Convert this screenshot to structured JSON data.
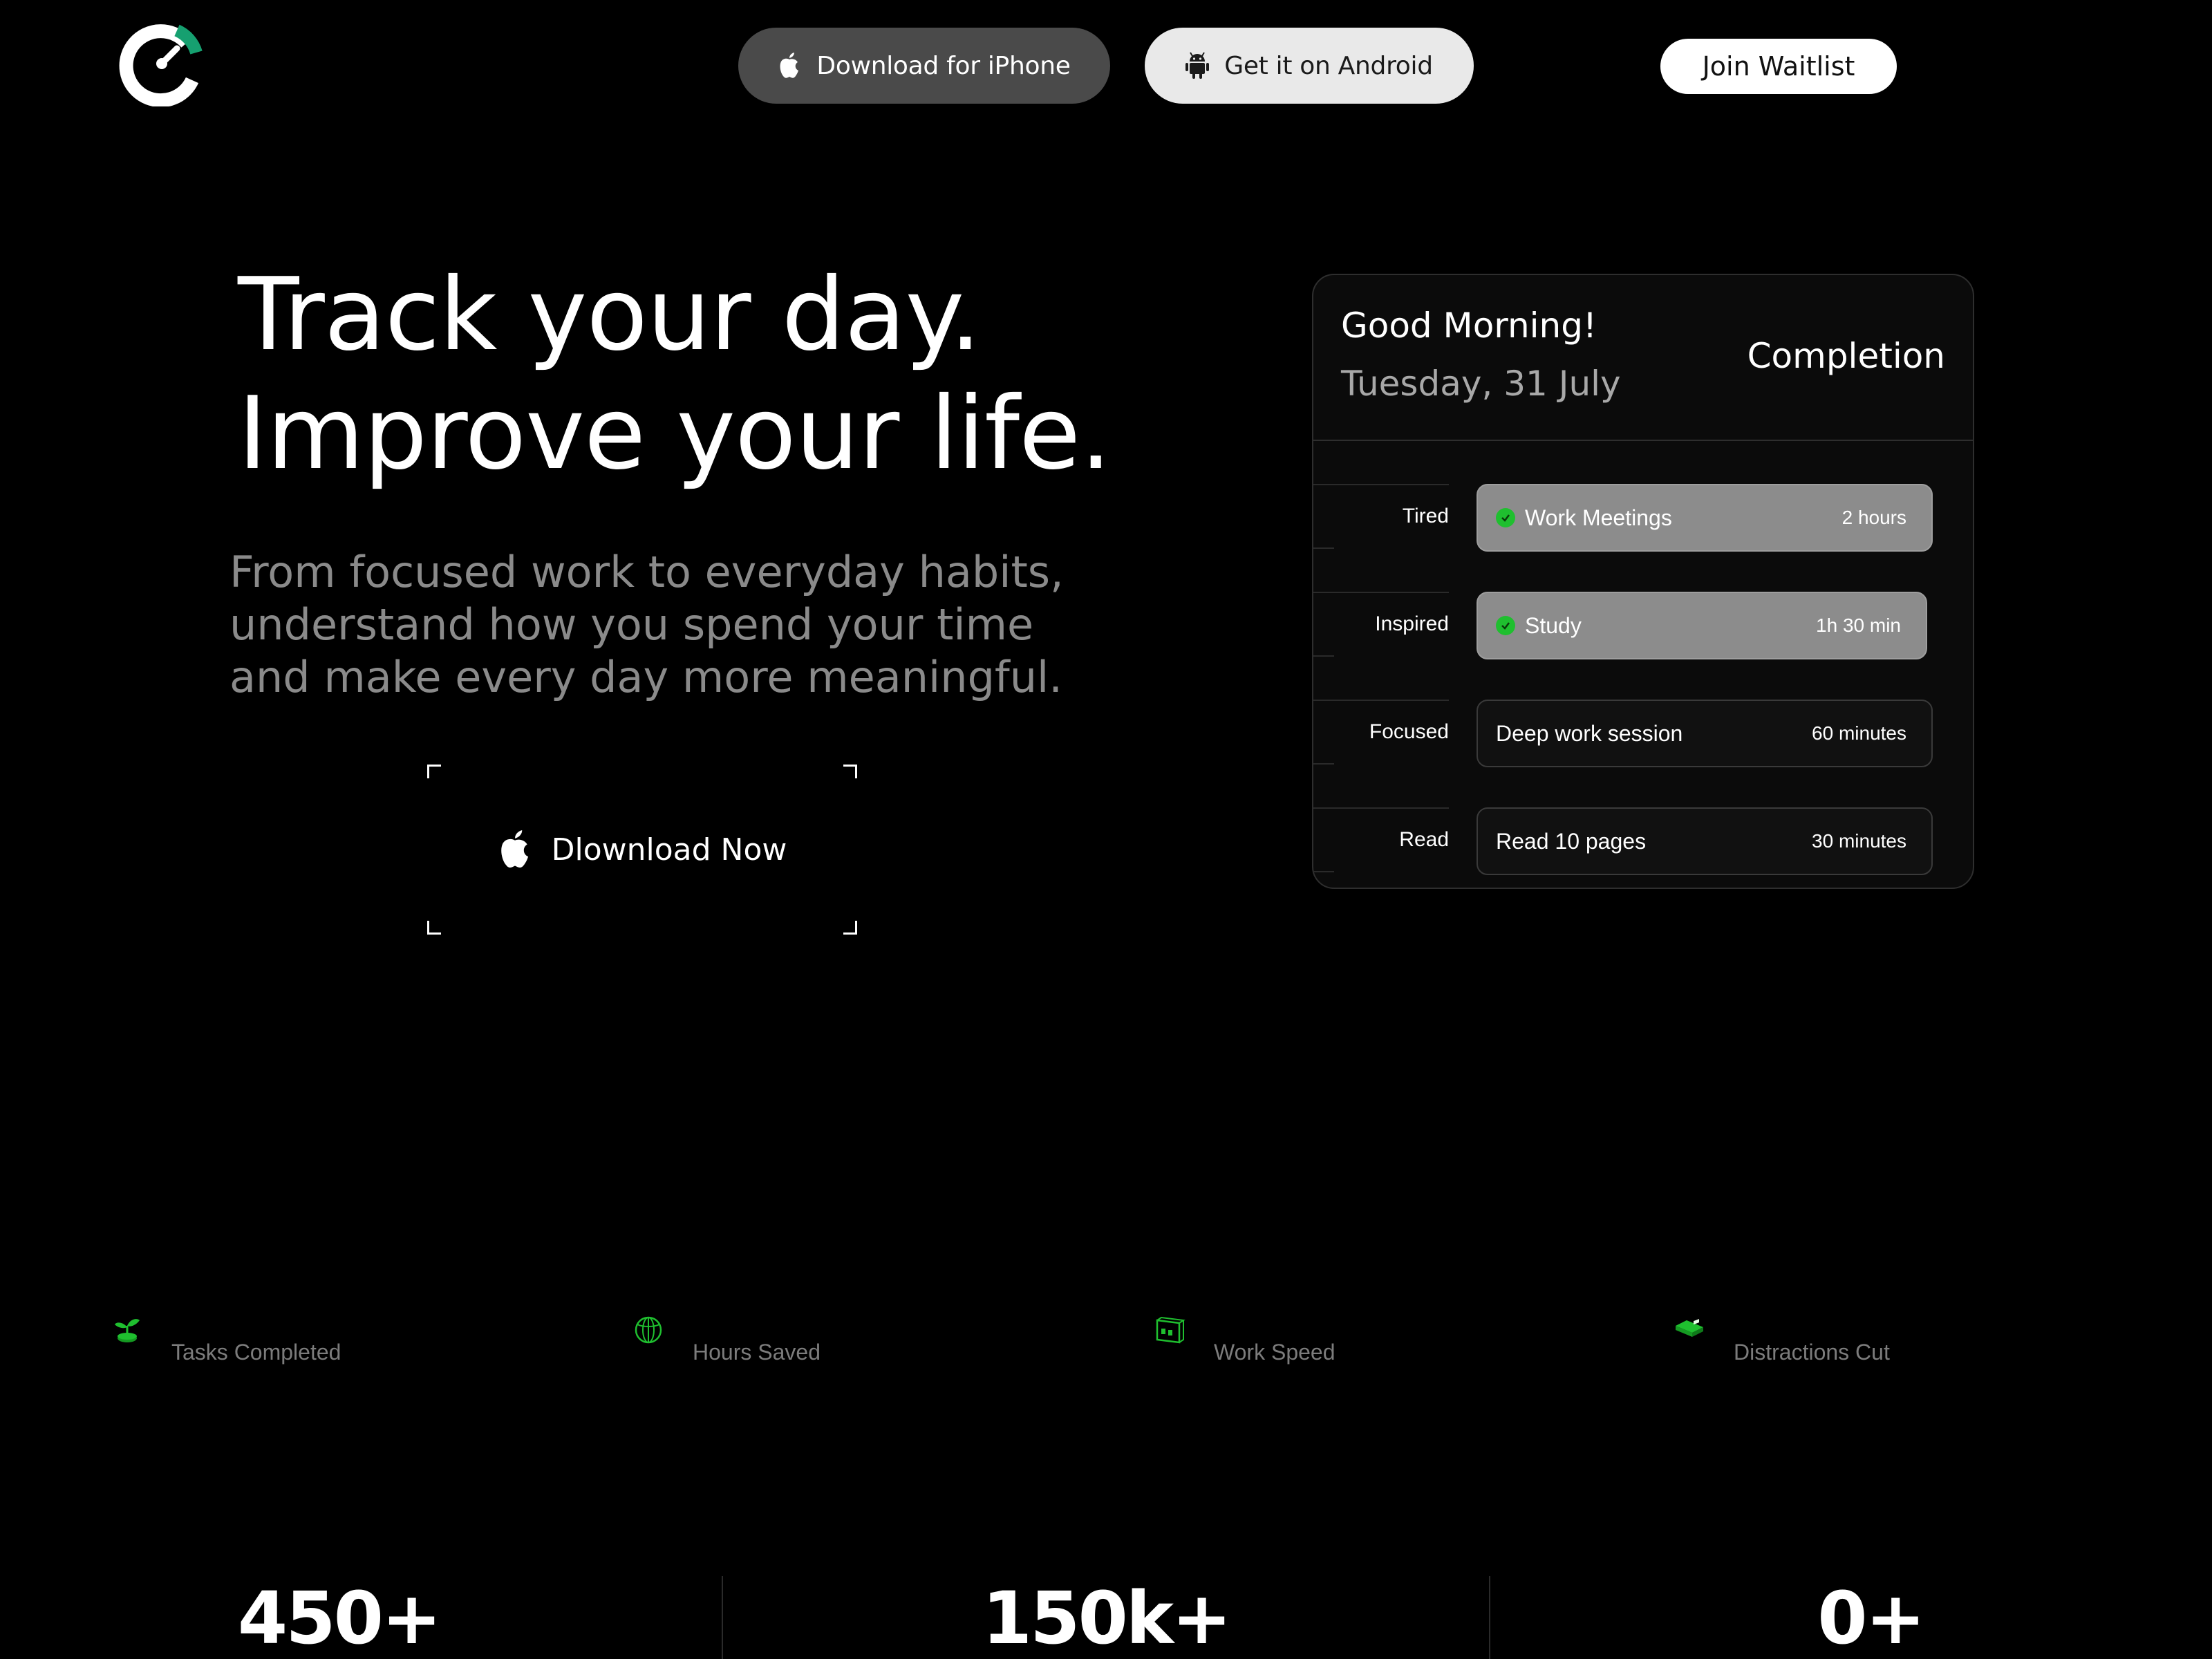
{
  "header": {
    "iphone_label": "Download for iPhone",
    "android_label": "Get it on Android",
    "waitlist_label": "Join Waitlist"
  },
  "hero": {
    "title_line1": "Track your day.",
    "title_line2": "Improve your life.",
    "subtitle_line1": "From focused work to everyday habits,",
    "subtitle_line2": "understand how you spend your time",
    "subtitle_line3": "and make every day more meaningful.",
    "download_label": "Dlownload Now"
  },
  "card": {
    "greeting": "Good Morning!",
    "date": "Tuesday, 31 July",
    "completion_label": "Completion",
    "rows": [
      {
        "mood": "Tired",
        "task": "Work Meetings",
        "duration": "2 hours",
        "done": true
      },
      {
        "mood": "Inspired",
        "task": "Study",
        "duration": "1h 30 min",
        "done": true
      },
      {
        "mood": "Focused",
        "task": "Deep work session",
        "duration": "60 minutes",
        "done": false
      },
      {
        "mood": "Read",
        "task": "Read 10 pages",
        "duration": "30 minutes",
        "done": false
      }
    ]
  },
  "stats": {
    "items": [
      {
        "icon": "sprout-icon",
        "label": "Tasks Completed"
      },
      {
        "icon": "globe-icon",
        "label": "Hours Saved"
      },
      {
        "icon": "speed-window-icon",
        "label": "Work Speed"
      },
      {
        "icon": "eraser-block-icon",
        "label": "Distractions Cut"
      }
    ],
    "numbers": [
      "450+",
      "150k+",
      "0+"
    ]
  },
  "colors": {
    "background": "#000000",
    "accent_green": "#1fbf2f",
    "logo_teal": "#1a8f6a",
    "muted_text": "#8a8a8a"
  }
}
